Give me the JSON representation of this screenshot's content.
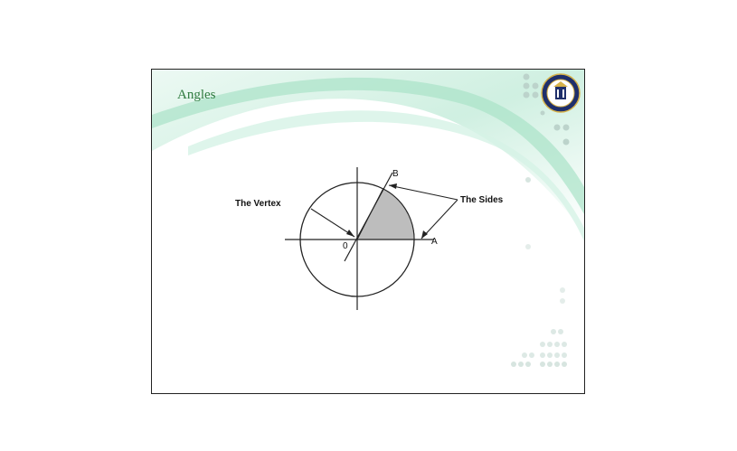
{
  "slide": {
    "title": "Angles",
    "logo_text": "HILLSBOROUGH COMMUNITY COLLEGE"
  },
  "diagram": {
    "vertex_label": "The Vertex",
    "sides_label": "The Sides",
    "point_a": "A",
    "point_b": "B",
    "origin": "0"
  },
  "colors": {
    "title": "#2e7a3e",
    "swoosh": "#bfe9d6",
    "sector": "#bdbdbd"
  }
}
